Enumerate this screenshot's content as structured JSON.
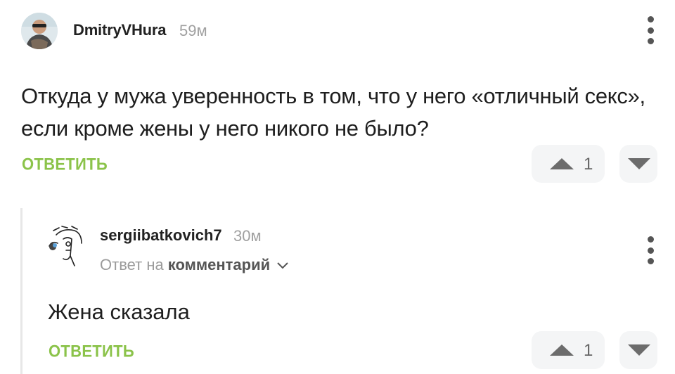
{
  "comment1": {
    "author": "DmitryVHura",
    "time": "59м",
    "text": "Откуда у мужа уверенность в том, что у него «отличный секс», если кроме жены у него никого не было?",
    "reply_label": "ОТВЕТИТЬ",
    "upvotes": "1"
  },
  "comment2": {
    "author": "sergiibatkovich7",
    "time": "30м",
    "reply_to_prefix": "Ответ на",
    "reply_to_link": "комментарий",
    "text": "Жена сказала",
    "reply_label": "ОТВЕТИТЬ",
    "upvotes": "1"
  },
  "colors": {
    "accent_green": "#8bc34a",
    "muted": "#a0a0a0",
    "vote_bg": "#f4f5f6"
  },
  "icons": {
    "more": "vertical-ellipsis",
    "upvote": "triangle-up",
    "downvote": "triangle-down",
    "expand": "chevron-down"
  }
}
